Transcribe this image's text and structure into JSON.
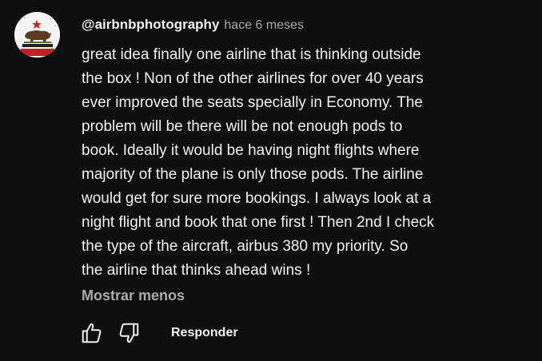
{
  "comment": {
    "author": "@airbnbphotography",
    "time": "hace 6 meses",
    "text": "great idea finally one airline that is thinking outside\nthe box !  Non of the other airlines for over 40 years\never improved the seats specially in Economy.   The\nproblem will be there will be not enough pods to\nbook.  Ideally  it would be having night flights where\nmajority of the plane is only those pods.  The airline\nwould get for sure more bookings.  I always look at a\nnight flight and book that one first !  Then 2nd I check\nthe type of the aircraft,  airbus 380  my priority.   So\nthe airline that thinks ahead wins !",
    "show_less_label": "Mostrar menos",
    "reply_label": "Responder"
  },
  "icons": {
    "like": "thumbs-up-icon",
    "dislike": "thumbs-down-icon"
  },
  "colors": {
    "background": "#0f0f0f",
    "text_primary": "#f1f1f1",
    "text_secondary": "#aaaaaa"
  }
}
